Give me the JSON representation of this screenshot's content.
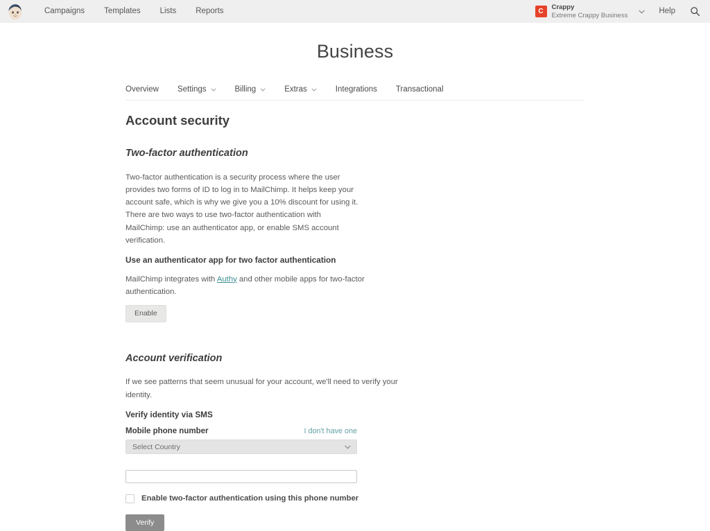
{
  "topbar": {
    "logo_alt": "MailChimp Freddie logo",
    "nav": [
      {
        "label": "Campaigns"
      },
      {
        "label": "Templates"
      },
      {
        "label": "Lists"
      },
      {
        "label": "Reports"
      }
    ],
    "account": {
      "badge_letter": "C",
      "primary": "Crappy",
      "secondary": "Extreme Crappy Business"
    },
    "help_label": "Help",
    "search_icon": "search-icon",
    "background_color": "#efefef",
    "badge_color": "#e6422a"
  },
  "page": {
    "title": "Business"
  },
  "tabs": [
    {
      "label": "Overview",
      "has_caret": false
    },
    {
      "label": "Settings",
      "has_caret": true
    },
    {
      "label": "Billing",
      "has_caret": true
    },
    {
      "label": "Extras",
      "has_caret": true
    },
    {
      "label": "Integrations",
      "has_caret": false
    },
    {
      "label": "Transactional",
      "has_caret": false
    }
  ],
  "main": {
    "section_title": "Account security",
    "two_factor": {
      "heading": "Two-factor authentication",
      "paragraph": "Two-factor authentication is a security process where the user provides two forms of ID to log in to MailChimp. It helps keep your account safe, which is why we give you a 10% discount for using it. There are two ways to use two-factor authentication with MailChimp: use an authenticator app, or enable SMS account verification.",
      "app_heading": "Use an authenticator app for two factor authentication",
      "app_text_before": "MailChimp integrates with ",
      "app_link": "Authy",
      "app_text_after": " and other mobile apps for two-factor authentication.",
      "enable_button": "Enable"
    },
    "account_verification": {
      "heading": "Account verification",
      "paragraph": "If we see patterns that seem unusual for your account, we'll need to verify your identity.",
      "sms_heading": "Verify identity via SMS",
      "phone_label": "Mobile phone number",
      "no_phone_link": "I don't have one",
      "country_select_value": "Select Country",
      "phone_input_value": "",
      "phone_input_placeholder": "",
      "checkbox_label": "Enable two-factor authentication using this phone number",
      "checkbox_checked": false,
      "verify_button": "Verify"
    }
  },
  "colors": {
    "link": "#3d8f94",
    "aux_link": "#63a0a4",
    "primary_button": "#8c8c8c",
    "secondary_button": "#e8e8e6"
  }
}
